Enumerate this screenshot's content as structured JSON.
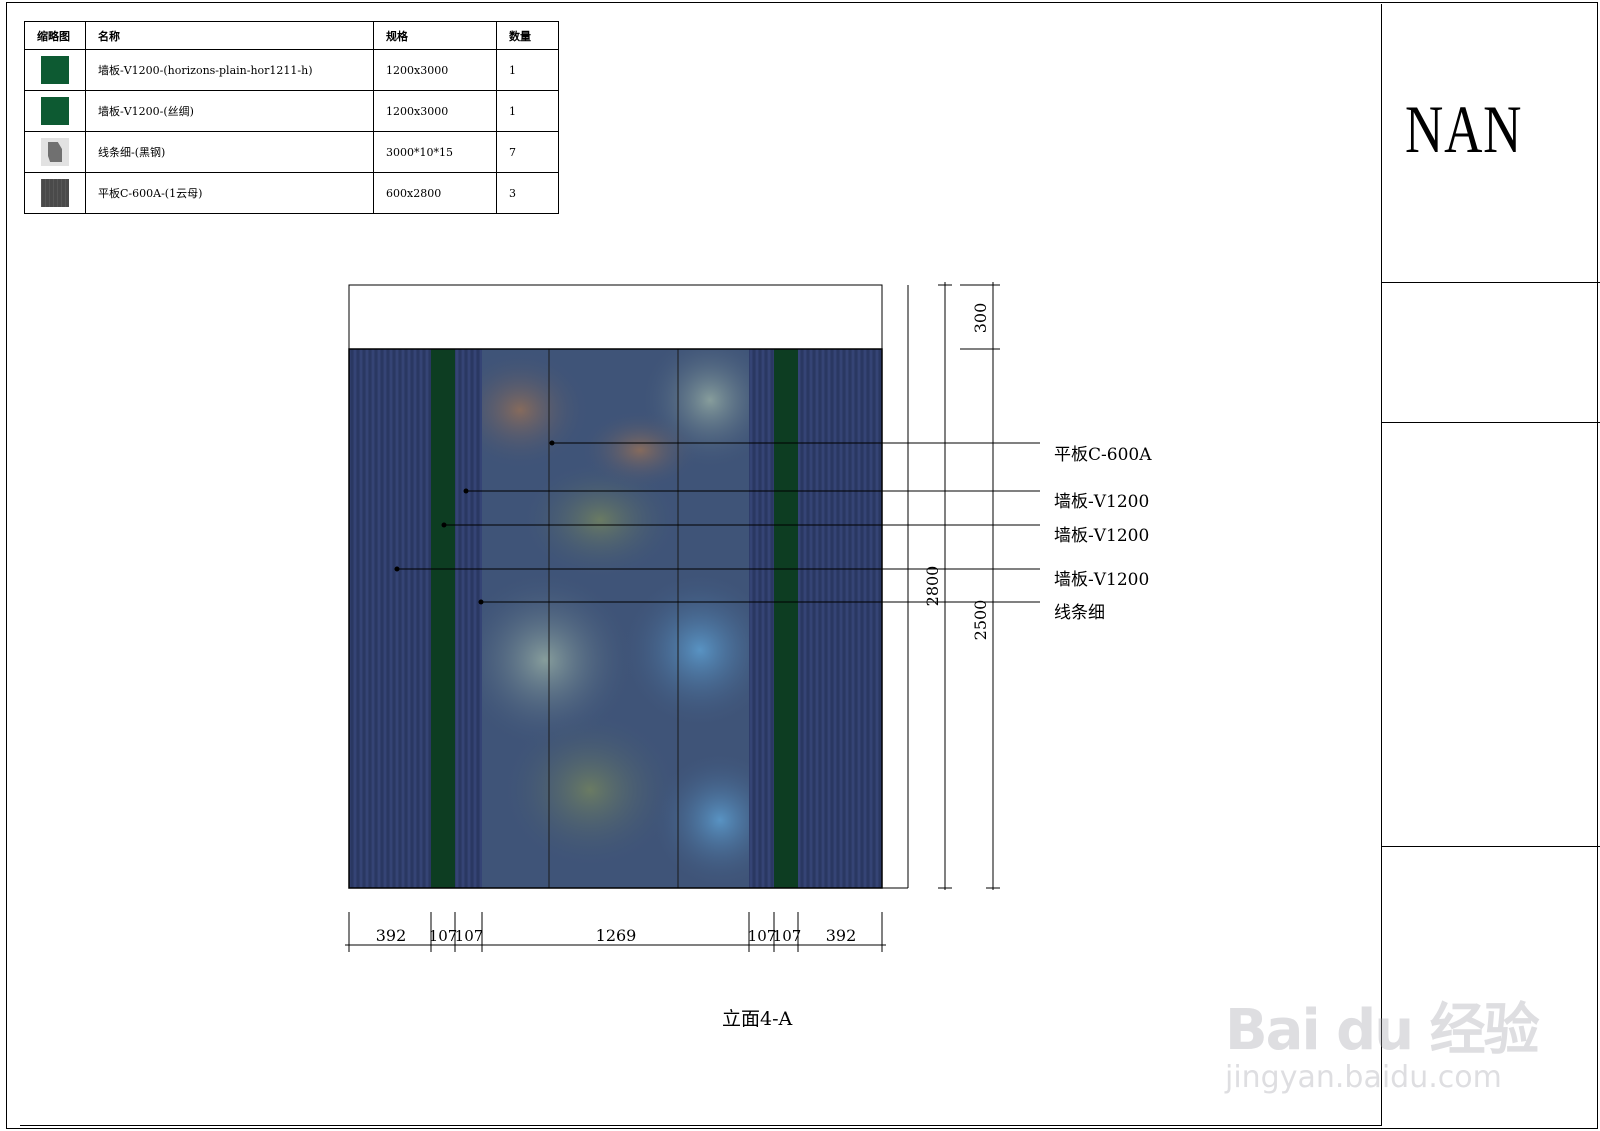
{
  "brand": "NAN",
  "legend": {
    "headers": [
      "缩略图",
      "名称",
      "规格",
      "数量"
    ],
    "rows": [
      {
        "swatch": "green",
        "name": "墙板-V1200-(horizons-plain-hor1211-h)",
        "spec": "1200x3000",
        "qty": "1"
      },
      {
        "swatch": "green",
        "name": "墙板-V1200-(丝绸)",
        "spec": "1200x3000",
        "qty": "1"
      },
      {
        "swatch": "grey",
        "name": "线条细-(黑钢)",
        "spec": "3000*10*15",
        "qty": "7"
      },
      {
        "swatch": "dark",
        "name": "平板C-600A-(1云母)",
        "spec": "600x2800",
        "qty": "3"
      }
    ]
  },
  "elevation": {
    "callouts": [
      "平板C-600A",
      "墙板-V1200",
      "墙板-V1200",
      "墙板-V1200",
      "线条细"
    ],
    "dim_horizontal": [
      "392",
      "107",
      "107",
      "1269",
      "107",
      "107",
      "392"
    ],
    "dim_vertical": {
      "top": "300",
      "middle": "2500",
      "total": "2800"
    },
    "caption": "立面4-A"
  },
  "colors": {
    "panel_blue": "#2f3d6a",
    "panel_green": "#0d3d22",
    "mural_base": "#3f5478"
  },
  "watermark": {
    "main": "Bai du 经验",
    "sub": "jingyan.baidu.com"
  }
}
